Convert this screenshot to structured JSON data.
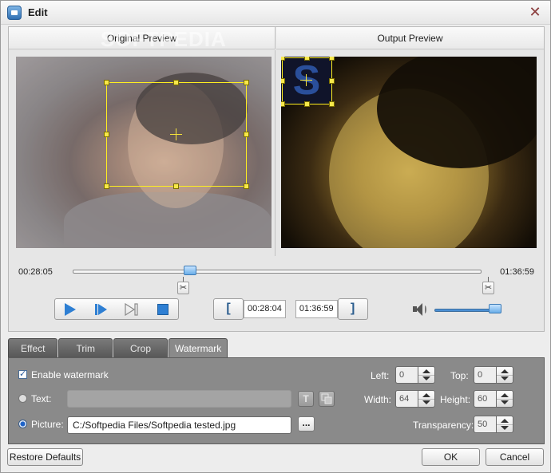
{
  "window": {
    "title": "Edit"
  },
  "preview": {
    "original_label": "Original Preview",
    "output_label": "Output Preview",
    "watermark_brand": "SOFTPEDIA",
    "output_logo_letter": "S"
  },
  "timeline": {
    "current_time": "00:28:05",
    "total_time": "01:36:59",
    "position_fraction": 0.287
  },
  "trim": {
    "start_button": "[",
    "start_time": "00:28:04",
    "end_time": "01:36:59",
    "end_button": "]"
  },
  "volume": {
    "level_fraction": 0.9
  },
  "tabs": [
    {
      "label": "Effect"
    },
    {
      "label": "Trim"
    },
    {
      "label": "Crop"
    },
    {
      "label": "Watermark",
      "active": true
    }
  ],
  "watermark": {
    "enable_label": "Enable watermark",
    "enable_checked": true,
    "text_label": "Text:",
    "text_value": "",
    "text_font_button": "T",
    "picture_label": "Picture:",
    "picture_path": "C:/Softpedia Files/Softpedia tested.jpg",
    "browse_button": "...",
    "left_label": "Left:",
    "left_value": "0",
    "top_label": "Top:",
    "top_value": "0",
    "width_label": "Width:",
    "width_value": "64",
    "height_label": "Height:",
    "height_value": "60",
    "transparency_label": "Transparency:",
    "transparency_value": "50"
  },
  "buttons": {
    "restore_defaults": "Restore Defaults",
    "ok": "OK",
    "cancel": "Cancel"
  }
}
